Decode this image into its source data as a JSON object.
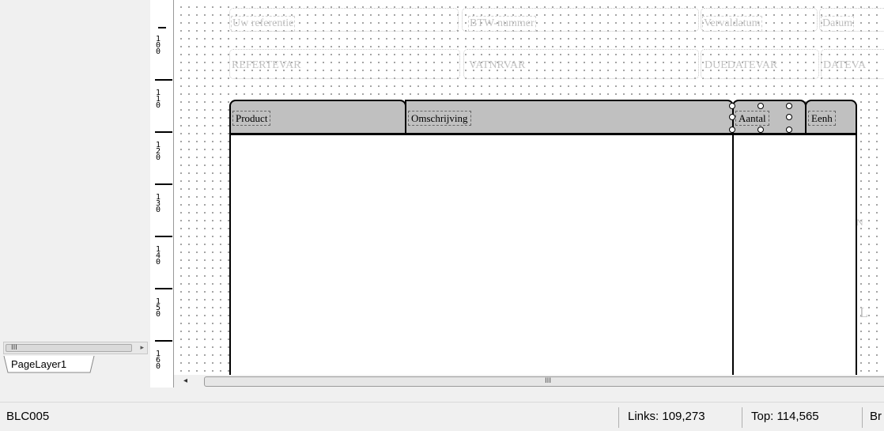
{
  "layers": {
    "active_tab": "PageLayer1",
    "scroll_thumb_glyph": "III",
    "scroll_right_glyph": "▸"
  },
  "ruler": {
    "labels": [
      "1\n0\n0",
      "1\n1\n0",
      "1\n2\n0",
      "1\n3\n0",
      "1\n4\n0",
      "1\n5\n0",
      "1\n6\n0"
    ]
  },
  "report": {
    "header_labels": [
      "Uw referentie",
      "BTW-nummer",
      "Vervaldatum",
      "Datum"
    ],
    "header_values": [
      "REFERTEVAR",
      "VATNRVAR",
      "DUEDATEVAR",
      "DATEVA"
    ],
    "columns": [
      "Product",
      "Omschrijving",
      "Aantal",
      "Eenh"
    ],
    "ghost_fragments": [
      "N",
      "L"
    ]
  },
  "hscroll": {
    "left_arrow": "◂",
    "thumb_glyph": "III"
  },
  "status": {
    "doc": "BLC005",
    "links": "Links: 109,273",
    "top": "Top: 114,565",
    "extra": "Br"
  }
}
